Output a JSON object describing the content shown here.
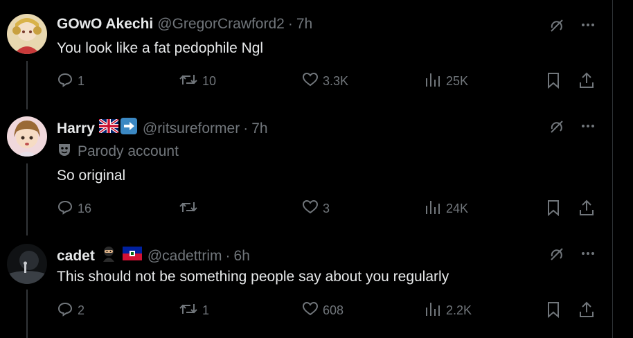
{
  "tweets": [
    {
      "name": "GOwO Akechi",
      "handle": "@GregorCrawford2",
      "time": "7h",
      "text": "You look like a fat pedophile Ngl",
      "replies": "1",
      "reposts": "10",
      "likes": "3.3K",
      "views": "25K"
    },
    {
      "name": "Harry",
      "handle": "@ritsureformer",
      "time": "7h",
      "label": "Parody account",
      "text": "So original",
      "replies": "16",
      "reposts": "",
      "likes": "3",
      "views": "24K"
    },
    {
      "name": "cadet",
      "handle": "@cadettrim",
      "time": "6h",
      "text": "This should not be something people say about you regularly",
      "replies": "2",
      "reposts": "1",
      "likes": "608",
      "views": "2.2K"
    }
  ],
  "separator": "·",
  "colors": {
    "background": "#000000",
    "text": "#e7e9ea",
    "muted": "#71767b",
    "line": "#333639"
  },
  "icons": [
    "reply-icon",
    "repost-icon",
    "like-icon",
    "views-icon",
    "bookmark-icon",
    "share-icon",
    "grok-icon",
    "more-icon",
    "parody-mask-icon",
    "uk-flag-icon",
    "arrow-right-icon",
    "ninja-icon",
    "haiti-flag-icon"
  ]
}
